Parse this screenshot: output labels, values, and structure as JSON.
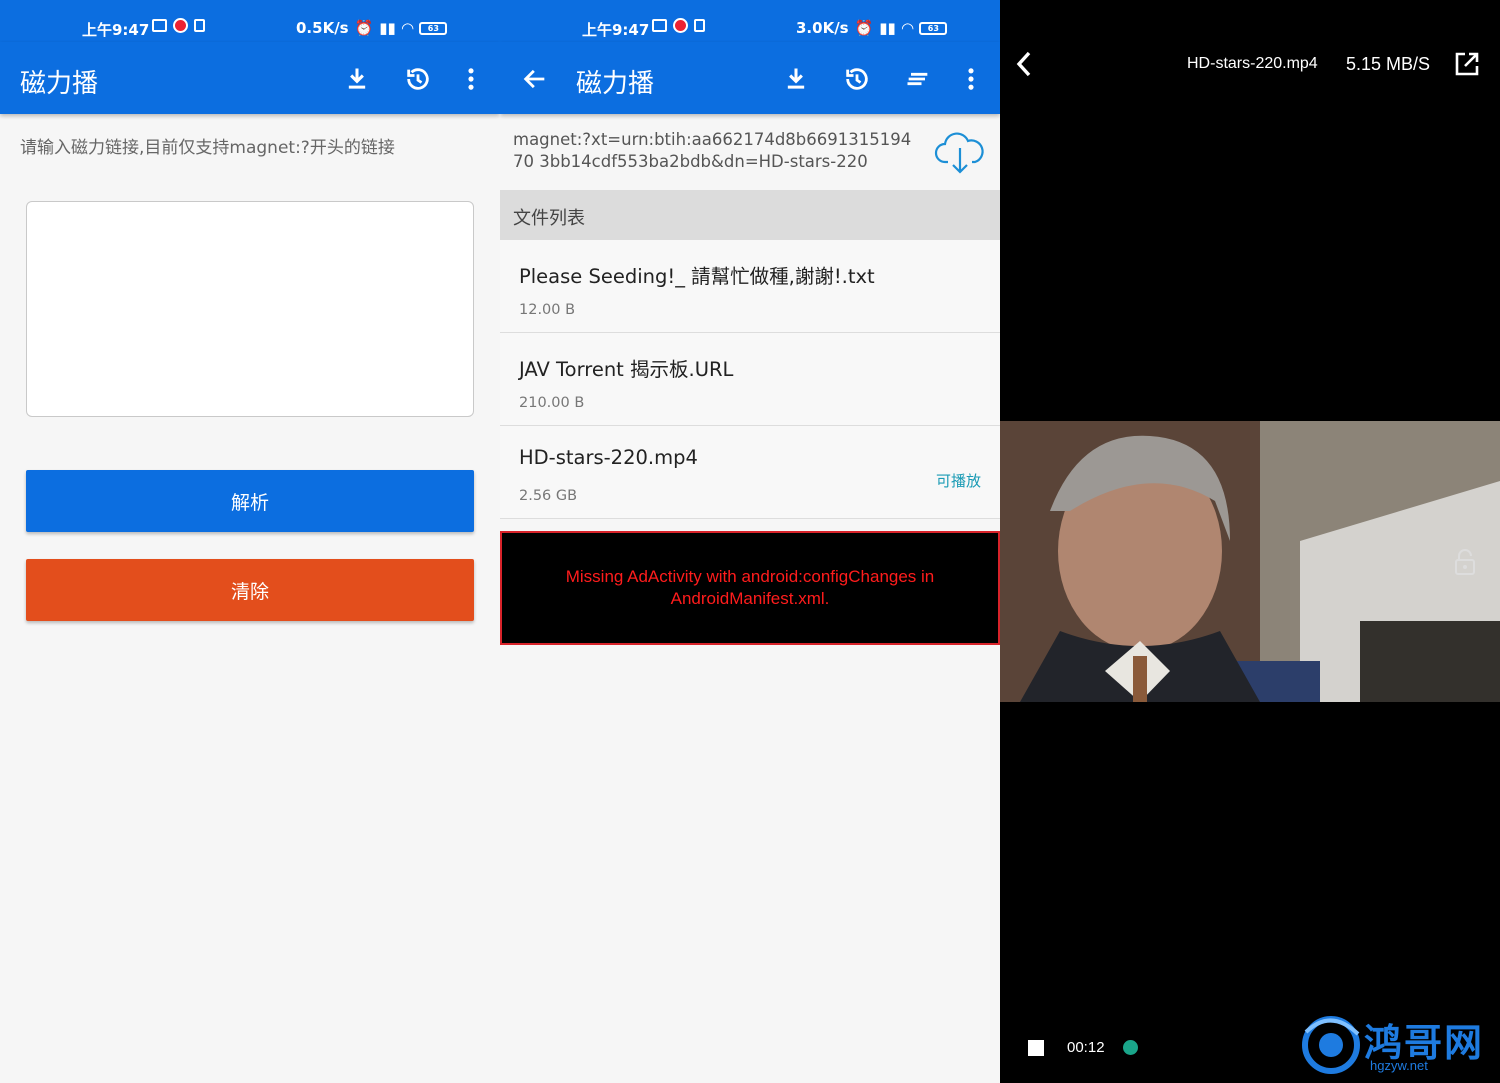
{
  "status_left": {
    "time": "上午9:47",
    "net_speed": "0.5K/s",
    "battery": "63"
  },
  "status_mid": {
    "time": "上午9:47",
    "net_speed": "3.0K/s",
    "battery": "63"
  },
  "screen1": {
    "app_title": "磁力播",
    "hint": "请输入磁力链接,目前仅支持magnet:?开头的链接",
    "input_value": "",
    "parse_label": "解析",
    "clear_label": "清除"
  },
  "screen2": {
    "app_title": "磁力播",
    "magnet_link": "magnet:?xt=urn:btih:aa662174d8b669131519470 3bb14cdf553ba2bdb&dn=HD-stars-220",
    "file_list_header": "文件列表",
    "files": [
      {
        "name": "Please Seeding!_ 請幫忙做種,謝謝!.txt",
        "size": "12.00 B",
        "playable": ""
      },
      {
        "name": "JAV Torrent 揭示板.URL",
        "size": "210.00 B",
        "playable": ""
      },
      {
        "name": "HD-stars-220.mp4",
        "size": "2.56 GB",
        "playable": "可播放"
      }
    ],
    "ad_error": "Missing AdActivity with android:configChanges in AndroidManifest.xml."
  },
  "screen3": {
    "file_name": "HD-stars-220.mp4",
    "speed": "5.15 MB/S",
    "current_time": "00:12",
    "watermark_text": "鸿哥网",
    "watermark_url": "hgzyw.net"
  },
  "colors": {
    "primary": "#0c6ee0",
    "clear": "#e34e1c",
    "error": "#ff1c1c",
    "accent": "#1a9bb5"
  },
  "icons": [
    "download-icon",
    "history-icon",
    "more-vert-icon",
    "back-arrow-icon",
    "sort-icon",
    "cloud-download-icon",
    "chevron-left-icon",
    "open-external-icon",
    "lock-icon",
    "stop-icon"
  ]
}
